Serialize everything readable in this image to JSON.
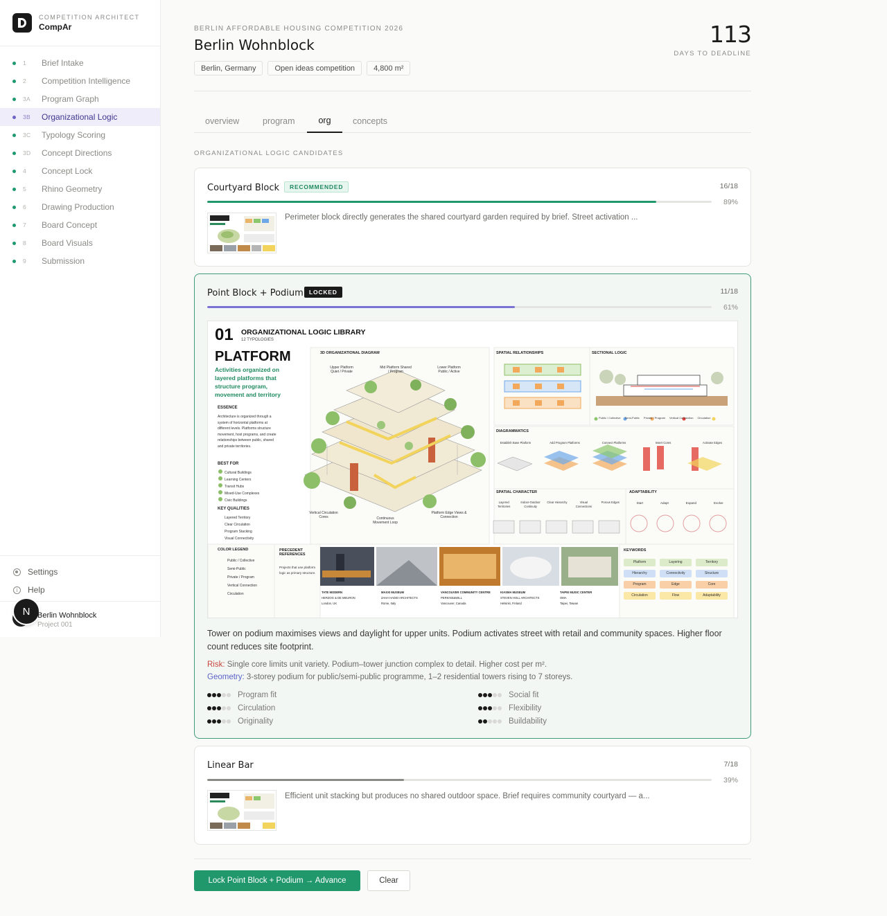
{
  "sidebar": {
    "brand_eyebrow": "COMPETITION ARCHITECT",
    "brand_name": "CompAr",
    "items": [
      {
        "num": "1",
        "label": "Brief Intake"
      },
      {
        "num": "2",
        "label": "Competition Intelligence"
      },
      {
        "num": "3A",
        "label": "Program Graph"
      },
      {
        "num": "3B",
        "label": "Organizational Logic"
      },
      {
        "num": "3C",
        "label": "Typology Scoring"
      },
      {
        "num": "3D",
        "label": "Concept Directions"
      },
      {
        "num": "4",
        "label": "Concept Lock"
      },
      {
        "num": "5",
        "label": "Rhino Geometry"
      },
      {
        "num": "6",
        "label": "Drawing Production"
      },
      {
        "num": "7",
        "label": "Board Concept"
      },
      {
        "num": "8",
        "label": "Board Visuals"
      },
      {
        "num": "9",
        "label": "Submission"
      }
    ],
    "settings_label": "Settings",
    "help_label": "Help",
    "avatar_letter": "N",
    "user_name": "Berlin Wohnblock",
    "user_sub": "Project 001"
  },
  "header": {
    "eyebrow": "BERLIN AFFORDABLE HOUSING COMPETITION 2026",
    "title": "Berlin Wohnblock",
    "chips": [
      "Berlin, Germany",
      "Open ideas competition",
      "4,800 m²"
    ],
    "days_number": "113",
    "days_label": "DAYS TO DEADLINE"
  },
  "tabs": [
    "overview",
    "program",
    "org",
    "concepts"
  ],
  "active_tab": "org",
  "section_label": "ORGANIZATIONAL LOGIC CANDIDATES",
  "candidates": [
    {
      "title": "Courtyard Block",
      "badge": "RECOMMENDED",
      "score": "16/18",
      "percent": "89%",
      "fraction": 0.89,
      "bar_color": "#21976c",
      "desc": "Perimeter block directly generates the shared courtyard garden required by brief. Street activation ..."
    },
    {
      "title": "Point Block + Podium",
      "badge": "LOCKED",
      "score": "11/18",
      "percent": "61%",
      "fraction": 0.61,
      "bar_color": "#7a72d4",
      "long_desc": "Tower on podium maximises views and daylight for upper units. Podium activates street with retail and community spaces. Higher floor count reduces site footprint.",
      "risk_label": "Risk:",
      "risk_text": " Single core limits unit variety. Podium–tower junction complex to detail. Higher cost per m².",
      "geometry_label": "Geometry:",
      "geometry_text": " 3-storey podium for public/semi-public programme, 1–2 residential towers rising to 7 storeys.",
      "metrics": [
        {
          "label": "Program fit",
          "value": 3,
          "max": 5
        },
        {
          "label": "Social fit",
          "value": 3,
          "max": 5
        },
        {
          "label": "Circulation",
          "value": 3,
          "max": 5
        },
        {
          "label": "Flexibility",
          "value": 3,
          "max": 5
        },
        {
          "label": "Originality",
          "value": 3,
          "max": 5
        },
        {
          "label": "Buildability",
          "value": 2,
          "max": 5
        }
      ]
    },
    {
      "title": "Linear Bar",
      "score": "7/18",
      "percent": "39%",
      "fraction": 0.39,
      "bar_color": "#8a8a86",
      "desc": "Efficient unit stacking but produces no shared outdoor space. Brief requires community courtyard — a..."
    }
  ],
  "board": {
    "number": "01",
    "heading": "ORGANIZATIONAL LOGIC LIBRARY",
    "subheading": "12 TYPOLOGIES",
    "name": "PLATFORM",
    "tagline": "Activities organized on layered platforms that structure program, movement and territory",
    "essence_title": "ESSENCE",
    "essence_text": "Architecture is organized through a system of horizontal platforms at different levels. Platforms structure movement, host programs, and create relationships between public, shared and private territories.",
    "best_for_title": "BEST FOR",
    "best_for": [
      "Cultural Buildings",
      "Learning Centers",
      "Transit Hubs",
      "Mixed-Use Complexes",
      "Civic Buildings"
    ],
    "key_qualities_title": "KEY QUALITIES",
    "key_qualities": [
      "Layered Territory",
      "Clear Circulation",
      "Program Stacking",
      "Visual Connectivity"
    ],
    "diagram_title": "3D ORGANIZATIONAL DIAGRAM",
    "diagram_labels": [
      "Upper Platform Quiet / Private",
      "Mid Platform Shared / Program",
      "Lower Platform Public / Active",
      "Vertical Circulation Cores",
      "Continuous Movement Loop",
      "Platform Edge Views & Connection"
    ],
    "spatial_relationships_title": "SPATIAL RELATIONSHIPS",
    "sectional_logic_title": "SECTIONAL LOGIC",
    "section_legend": [
      "Public / Collective",
      "Semi-Public",
      "Private / Program",
      "Vertical Connection",
      "Circulation"
    ],
    "diagrammatics_title": "DIAGRAMMATICS",
    "diagrammatics_steps": [
      "Establish Base Platform",
      "Add Program Platforms",
      "Connect Platforms",
      "Insert Cores",
      "Activate Edges"
    ],
    "spatial_character_title": "SPATIAL CHARACTER",
    "spatial_character": [
      "Layered Territories",
      "Indoor-Outdoor Continuity",
      "Clear Hierarchy",
      "Visual Connections",
      "Porous Edges"
    ],
    "adaptability_title": "ADAPTABILITY",
    "adaptability": [
      "Start",
      "Adapt",
      "Expand",
      "Evolve"
    ],
    "color_legend_title": "COLOR LEGEND",
    "color_legend": [
      "Public / Collective",
      "Semi-Public",
      "Private / Program",
      "Vertical Connection",
      "Circulation"
    ],
    "precedent_title": "PRECEDENT REFERENCES",
    "precedent_text": "Projects that use platform logic as primary structure.",
    "precedents": [
      {
        "name": "TATE MODERN",
        "arch": "HERZOG & DE MEURON",
        "place": "London, UK"
      },
      {
        "name": "MAXXI MUSEUM",
        "arch": "ZAHA HADID ARCHITECTS",
        "place": "Rome, Italy"
      },
      {
        "name": "VANCOUVER COMMUNITY CENTRE",
        "arch": "PERKINS&WILL",
        "place": "Vancouver, Canada"
      },
      {
        "name": "KIASMA MUSEUM",
        "arch": "STEVEN HOLL ARCHITECTS",
        "place": "Helsinki, Finland"
      },
      {
        "name": "TAIPEI MUSIC CENTER",
        "arch": "OMA",
        "place": "Taipei, Taiwan"
      }
    ],
    "keywords_title": "KEYWORDS",
    "keywords": [
      "Platform",
      "Layering",
      "Territory",
      "Hierarchy",
      "Connectivity",
      "Structure",
      "Program",
      "Edge",
      "Core",
      "Circulation",
      "Flow",
      "Adaptability"
    ],
    "colors": {
      "public": "#8cc66d",
      "semi": "#6fa8e8",
      "private": "#f2a95c",
      "vertical": "#e2463c",
      "circulation": "#f2d45c",
      "accent": "#1f8a60"
    }
  },
  "actions": {
    "primary": "Lock Point Block + Podium → Advance",
    "secondary": "Clear"
  }
}
